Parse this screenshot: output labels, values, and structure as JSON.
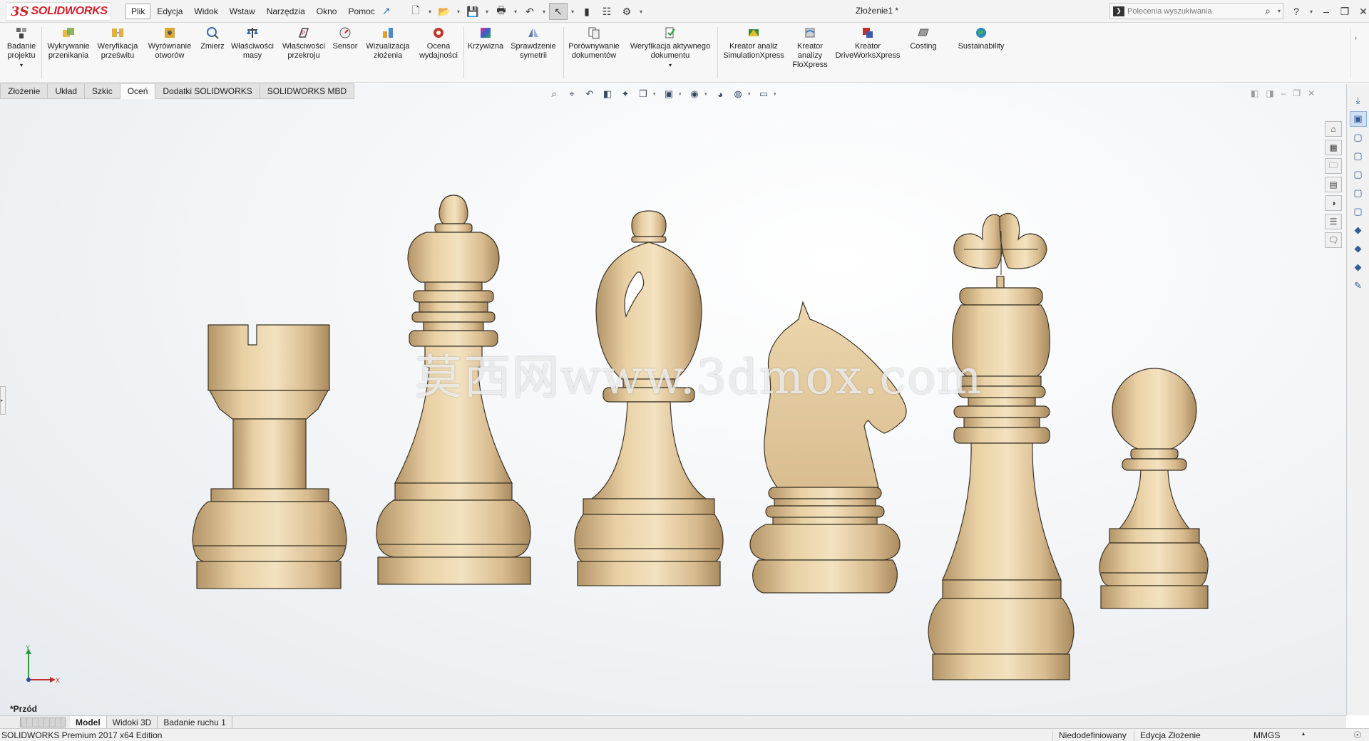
{
  "app": {
    "brand_ds": "3S",
    "brand_name": "SOLIDWORKS",
    "doc_title": "Złożenie1 *"
  },
  "menu": [
    "Plik",
    "Edycja",
    "Widok",
    "Wstaw",
    "Narzędzia",
    "Okno",
    "Pomoc"
  ],
  "search": {
    "placeholder": "Polecenia wyszukiwania"
  },
  "ribbon": {
    "badanie": [
      "Badanie",
      "projektu"
    ],
    "wykrywanie": [
      "Wykrywanie",
      "przenikania"
    ],
    "weryfikacja_przeswitu": [
      "Weryfikacja",
      "prześwitu"
    ],
    "wyrownanie": [
      "Wyrównanie",
      "otworów"
    ],
    "zmierz": "Zmierz",
    "wlasciwosci_masy": [
      "Właściwości",
      "masy"
    ],
    "wlasciwosci_przekroju": [
      "Właściwości",
      "przekroju"
    ],
    "sensor": "Sensor",
    "wizualizacja": [
      "Wizualizacja",
      "złożenia"
    ],
    "ocena_wydajnosci": [
      "Ocena",
      "wydajności"
    ],
    "krzywizna": "Krzywizna",
    "sprawdzenie_symetrii": [
      "Sprawdzenie",
      "symetrii"
    ],
    "porownywanie": [
      "Porównywanie",
      "dokumentów"
    ],
    "weryfikacja_aktywnego": [
      "Weryfikacja aktywnego",
      "dokumentu"
    ],
    "simulationxpress": [
      "Kreator analiz",
      "SimulationXpress"
    ],
    "floxpress": [
      "Kreator",
      "analizy",
      "FloXpress"
    ],
    "driveworks": [
      "Kreator",
      "DriveWorksXpress"
    ],
    "costing": "Costing",
    "sustainability": "Sustainability"
  },
  "cm_tabs": [
    "Złożenie",
    "Układ",
    "Szkic",
    "Oceń",
    "Dodatki SOLIDWORKS",
    "SOLIDWORKS MBD"
  ],
  "cm_tab_active": "Oceń",
  "graphics": {
    "watermark": "莫西网www.3dmox.com",
    "view_name": "*Przód",
    "triad_y": "Y",
    "triad_x": "X"
  },
  "model_tabs": [
    "Model",
    "Widoki 3D",
    "Badanie ruchu 1"
  ],
  "status": {
    "edition": "SOLIDWORKS Premium 2017 x64 Edition",
    "definition": "Niedodefiniowany",
    "mode": "Edycja Złożenie",
    "units": "MMGS"
  },
  "icons": {
    "wood_light": "#f0dcb4",
    "wood_mid": "#dcc096",
    "wood_dark": "#b39467",
    "edge": "#3a3226",
    "accent_blue": "#2e6fc1",
    "brand_red": "#d4202b"
  }
}
